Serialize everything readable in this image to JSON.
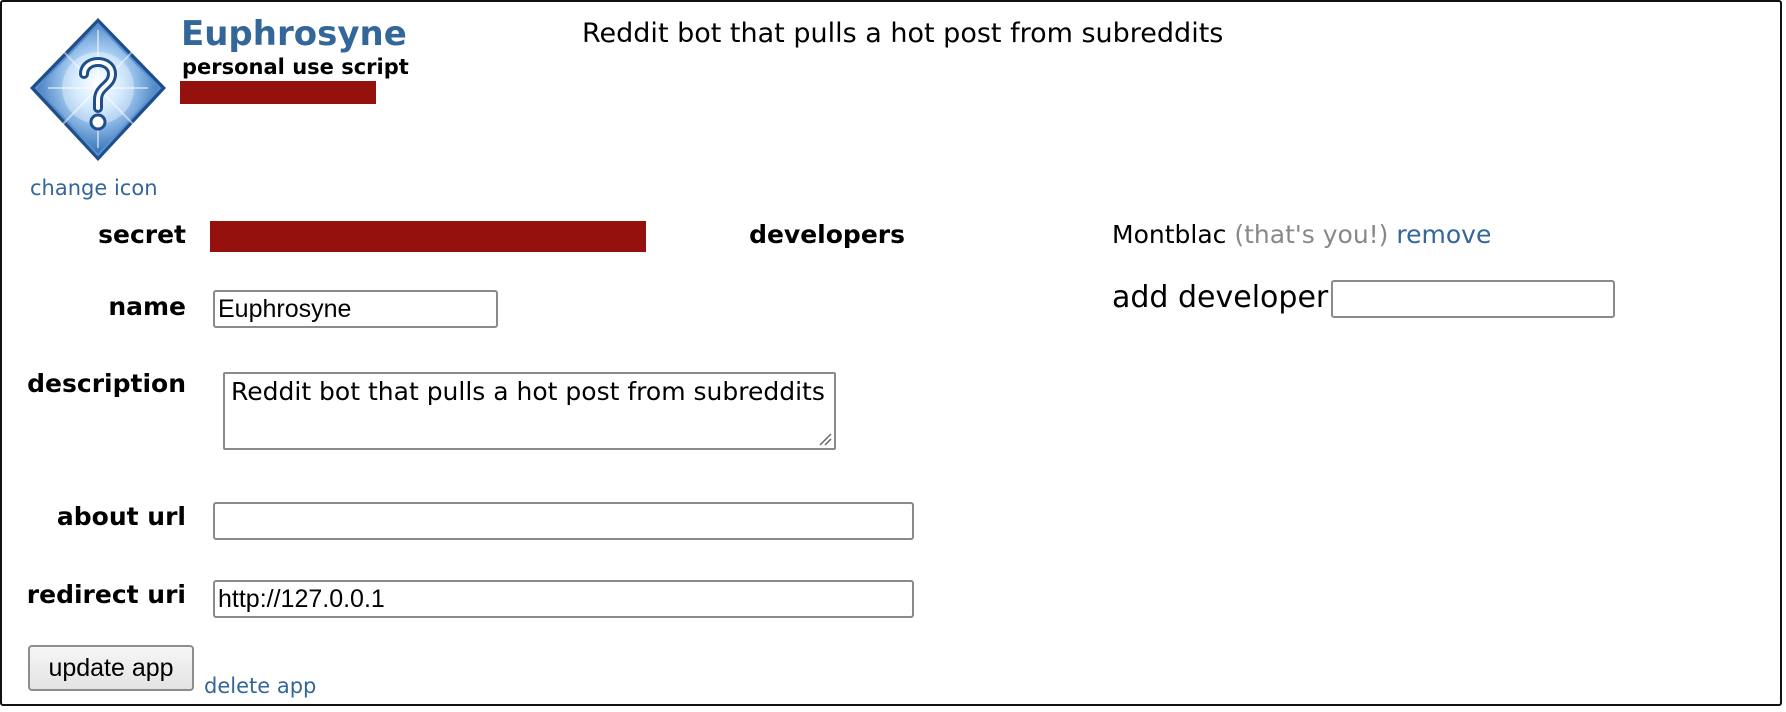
{
  "app": {
    "name": "Euphrosyne",
    "type": "personal use script",
    "description_header": "Reddit bot that pulls a hot post from subreddits",
    "change_icon_label": "change icon",
    "icon": "question-mark-diamond-icon"
  },
  "form": {
    "secret_label": "secret",
    "name_label": "name",
    "name_value": "Euphrosyne",
    "description_label": "description",
    "description_value": "Reddit bot that pulls a hot post from subreddits",
    "about_url_label": "about url",
    "about_url_value": "",
    "redirect_uri_label": "redirect uri",
    "redirect_uri_value": "http://127.0.0.1"
  },
  "developers": {
    "label": "developers",
    "name": "Montblac",
    "you_note": "(that's you!)",
    "remove_label": "remove",
    "add_label": "add developer:",
    "add_value": ""
  },
  "actions": {
    "update_label": "update app",
    "delete_label": "delete app"
  },
  "colors": {
    "link": "#336699",
    "redaction": "#94110d",
    "icon_blue": "#2f6fb5"
  }
}
